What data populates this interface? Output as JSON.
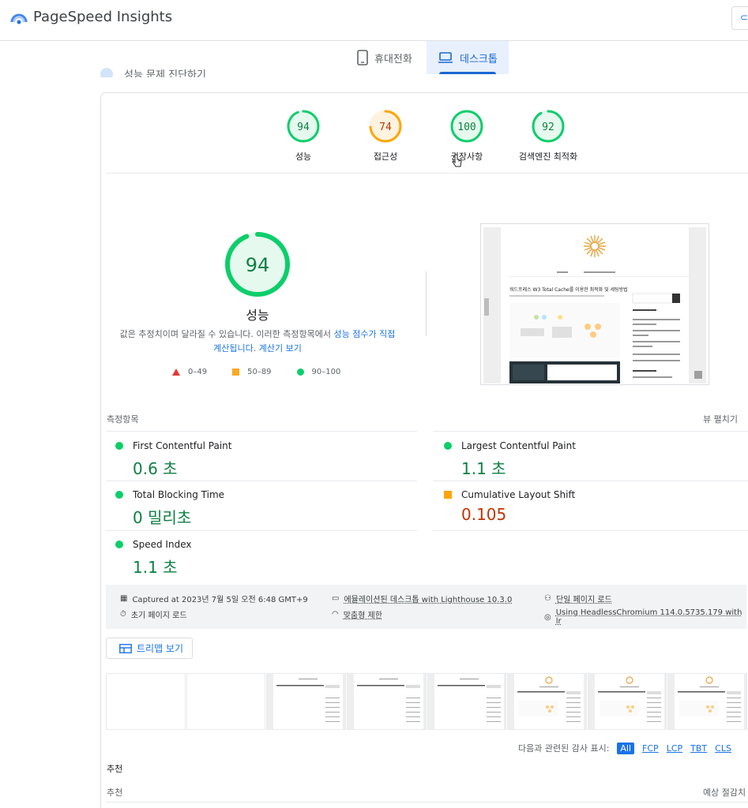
{
  "header": {
    "app_title": "PageSpeed Insights",
    "share_icon": "link-icon"
  },
  "device_tabs": [
    {
      "label": "휴대전화",
      "icon": "smartphone-icon",
      "selected": false
    },
    {
      "label": "데스크톱",
      "icon": "laptop-icon",
      "selected": true
    }
  ],
  "partial_section_text": "성능 문제 진단하기",
  "category_scores": [
    {
      "label": "성능",
      "score": "94",
      "value": 94,
      "color": "#0cce6b",
      "text_color": "#0d8043"
    },
    {
      "label": "접근성",
      "score": "74",
      "value": 74,
      "color": "#ffa400",
      "text_color": "#c33300"
    },
    {
      "label": "권장사항",
      "score": "100",
      "value": 100,
      "color": "#0cce6b",
      "text_color": "#0d8043"
    },
    {
      "label": "검색엔진 최적화",
      "score": "92",
      "value": 92,
      "color": "#0cce6b",
      "text_color": "#0d8043"
    }
  ],
  "performance": {
    "score": "94",
    "value": 94,
    "title": "성능",
    "note_prefix": "값은 추정치이며 달라질 수 있습니다. 이러한 측정항목에서 ",
    "note_link1": "성능 점수가 직접 계산됩니다",
    "note_mid": ". ",
    "note_link2": "계산기 보기",
    "legend": [
      {
        "range": "0–49",
        "shape": "triangle",
        "color": "#e53935"
      },
      {
        "range": "50–89",
        "shape": "square",
        "color": "#f9a825"
      },
      {
        "range": "90–100",
        "shape": "circle",
        "color": "#0cce6b"
      }
    ]
  },
  "screenshot_thumbnail": {
    "heading": "워드프레스 W3 Total Cache를 이용한 최적화 및 세팅방법"
  },
  "metrics": {
    "title": "측정항목",
    "expand_label": "뷰 펼치기",
    "items": [
      {
        "name": "First Contentful Paint",
        "value": "0.6 초",
        "status": "good"
      },
      {
        "name": "Largest Contentful Paint",
        "value": "1.1 초",
        "status": "good"
      },
      {
        "name": "Total Blocking Time",
        "value": "0 밀리초",
        "status": "good"
      },
      {
        "name": "Cumulative Layout Shift",
        "value": "0.105",
        "status": "average"
      },
      {
        "name": "Speed Index",
        "value": "1.1 초",
        "status": "good"
      }
    ]
  },
  "runtime": {
    "captured": "Captured at 2023년 7월 5일 오전 6:48 GMT+9",
    "emulation": "에뮬레이션된 데스크톱 with Lighthouse 10.3.0",
    "single_page": "단일 페이지 로드",
    "initial_load": "초기 페이지 로드",
    "throttling": "맞춤형 제한",
    "browser": "Using HeadlessChromium 114.0.5735.179 with lr"
  },
  "treemap_label": "트리맵 보기",
  "audit_filter": {
    "label": "다음과 관련된 감사 표시:",
    "chips": [
      "All",
      "FCP",
      "LCP",
      "TBT",
      "CLS"
    ]
  },
  "sections": {
    "first": "추천",
    "second": "추천",
    "savings": "예상 절감치"
  }
}
